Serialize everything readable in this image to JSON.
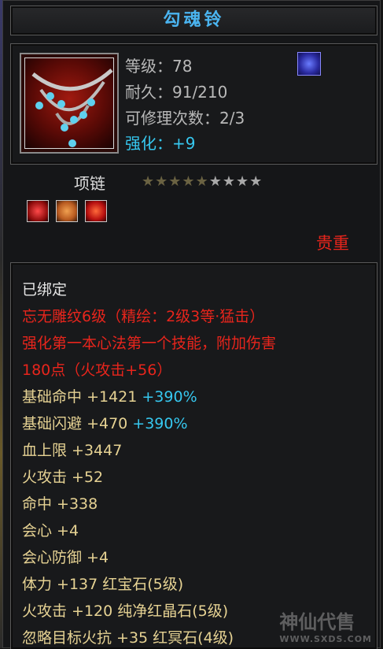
{
  "item": {
    "name": "勾魂铃",
    "level": "等级：78",
    "durability": "耐久：91/210",
    "repairs": "可修理次数：2/3",
    "enhance_label": "强化：",
    "enhance_value": "+9",
    "type": "项链",
    "stars_filled": 5,
    "stars_total": 9,
    "rarity": "贵重"
  },
  "icons": {
    "item_icon": "chain-necklace-icon",
    "skill_icon": "blue-flame-icon",
    "gems": [
      "red-gem-icon",
      "orange-gem-icon",
      "red-crystal-icon"
    ]
  },
  "desc": {
    "bound": "已绑定",
    "engrave1": "忘无雕纹6级（精绘：2级3等·猛击）",
    "engrave2": "强化第一本心法第一个技能，附加伤害",
    "engrave3": "180点（火攻击+56）",
    "stats": [
      {
        "label": "基础命中",
        "value": "+1421",
        "extra": "+390%"
      },
      {
        "label": "基础闪避",
        "value": "+470",
        "extra": "+390%"
      }
    ],
    "attrs": [
      "血上限  +3447",
      "火攻击  +52",
      "命中  +338",
      "会心  +4",
      "会心防御  +4",
      "体力  +137  红宝石(5级)",
      "火攻击  +120  纯净红晶石(5级)",
      "忽略目标火抗  +35  红冥石(4级)"
    ]
  },
  "watermark": {
    "main": "神仙代售",
    "url": "WWW.SXDS.COM"
  },
  "colors": {
    "title": "#4ab4f0",
    "enhance": "#36c8f0",
    "rarity": "#e8251c",
    "attr": "#e6d293"
  }
}
